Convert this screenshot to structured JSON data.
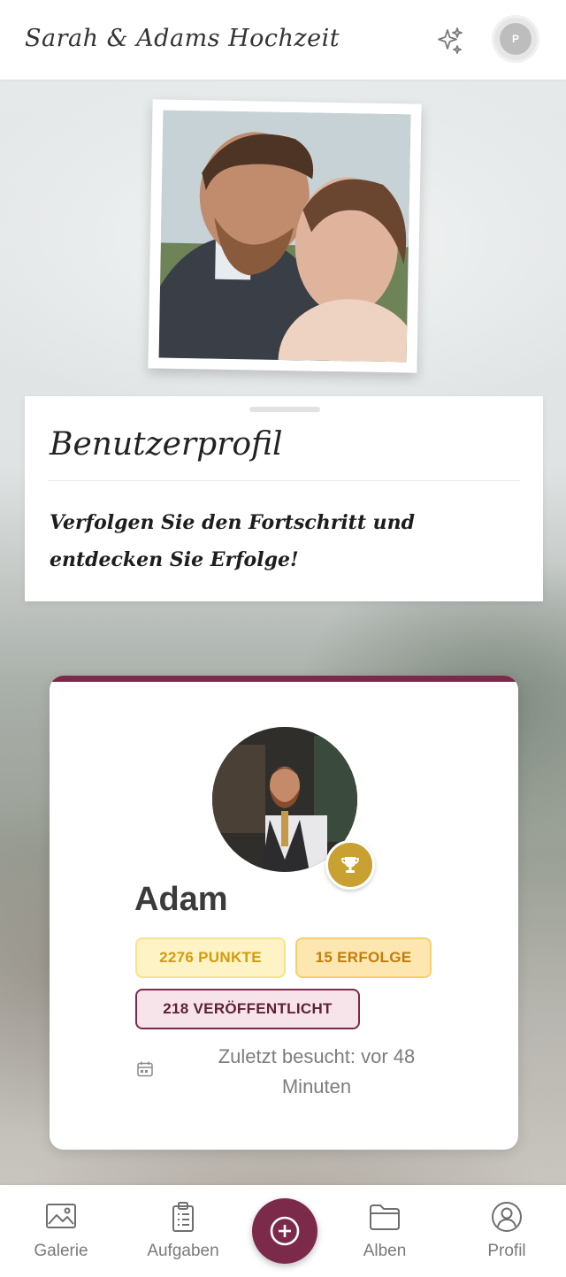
{
  "app": {
    "title": "Sarah & Adams Hochzeit",
    "header_icons": [
      "sparkles-icon",
      "avatar-icon"
    ],
    "avatar_initial": "P"
  },
  "profile_header": {
    "title": "Benutzerprofil",
    "subtitle": "Verfolgen Sie den Fortschritt und entdecken Sie Erfolge!"
  },
  "user": {
    "name": "Adam",
    "badges": {
      "points": "2276 PUNKTE",
      "achievements": "15 ERFOLGE",
      "published": "218 VERÖFFENTLICHT"
    },
    "last_visit": "Zuletzt besucht: vor 48 Minuten",
    "badge_icon": "trophy-icon"
  },
  "nav": {
    "items": [
      {
        "label": "Galerie",
        "icon": "gallery-icon"
      },
      {
        "label": "Aufgaben",
        "icon": "tasks-icon"
      },
      {
        "label": "Alben",
        "icon": "folder-icon"
      },
      {
        "label": "Profil",
        "icon": "profile-icon"
      }
    ],
    "add_icon": "plus-circle-icon"
  },
  "colors": {
    "accent": "#7c2a4a",
    "points_text": "#d29b11",
    "achievements_text": "#c07d0c",
    "trophy": "#c9a032"
  }
}
